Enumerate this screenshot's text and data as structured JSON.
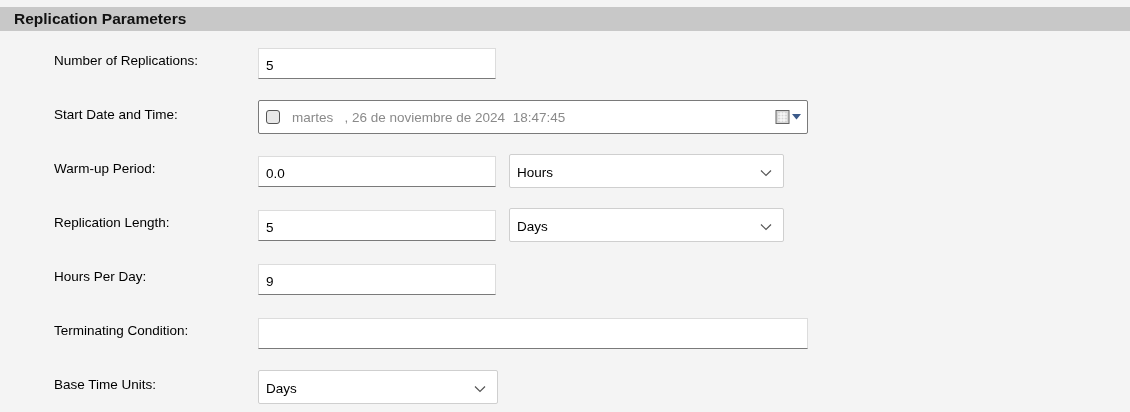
{
  "section": {
    "title": "Replication Parameters"
  },
  "fields": [
    {
      "kind": "number",
      "label": "Number of Replications:",
      "value": "5"
    },
    {
      "kind": "date",
      "label": "Start Date and Time:",
      "checked": false,
      "value": "martes   , 26 de noviembre de 2024  18:47:45"
    },
    {
      "kind": "quantity",
      "label": "Warm-up Period:",
      "value": "0.0",
      "unit": "Hours"
    },
    {
      "kind": "quantity",
      "label": "Replication Length:",
      "value": "5",
      "unit": "Days"
    },
    {
      "kind": "number",
      "label": "Hours Per Day:",
      "value": "9"
    },
    {
      "kind": "condition",
      "label": "Terminating Condition:"
    },
    {
      "kind": "choice",
      "label": "Base Time Units:",
      "value": "Days"
    }
  ]
}
